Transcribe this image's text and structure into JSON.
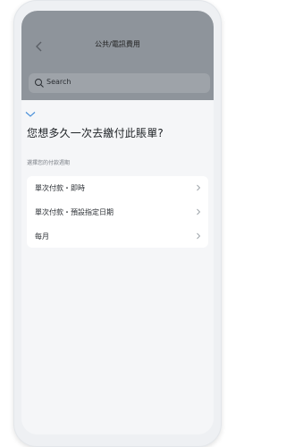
{
  "header": {
    "title": "公共/電訊費用"
  },
  "search": {
    "placeholder": "Search"
  },
  "sheet": {
    "question": "您想多久一次去繳付此賬單?",
    "subtitle": "選擇您的付款週期",
    "options": [
      {
        "label": "單次付款・即時"
      },
      {
        "label": "單次付款・預設指定日期"
      },
      {
        "label": "每月"
      }
    ]
  },
  "icons": {
    "back": "chevron-left-icon",
    "search": "search-icon",
    "collapse": "chevron-down-icon",
    "row": "chevron-right-icon"
  },
  "colors": {
    "accent": "#4a90d9",
    "overlay": "#8e949b"
  }
}
